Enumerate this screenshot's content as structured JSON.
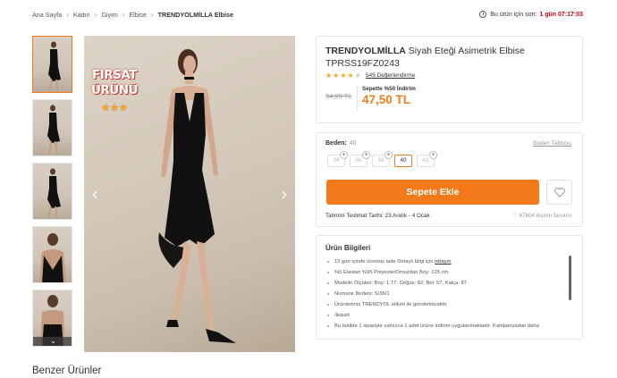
{
  "breadcrumb": [
    {
      "label": "Ana Sayfa"
    },
    {
      "label": "Kadın"
    },
    {
      "label": "Giyim"
    },
    {
      "label": "Elbise"
    },
    {
      "label": "TRENDYOLMİLLA Elbise"
    }
  ],
  "timer": {
    "label": "Bu ürün için son:",
    "value": "1 gün 07:17:03"
  },
  "badge": {
    "line1": "FIRSAT",
    "line2": "ÜRÜNÜ",
    "stars": "★★★"
  },
  "product": {
    "brand": "TRENDYOLMİLLA",
    "name": "Siyah Eteği Asimetrik Elbise",
    "code": "TPRSS19FZ0243",
    "rating": 4,
    "review_count": "549 Değerlendirme",
    "old_price": "94,99 TL",
    "discount_label": "Sepette %50 İndirim",
    "new_price": "47,50 TL"
  },
  "size": {
    "label": "Beden:",
    "selected": "40",
    "table_link": "Beden Tablosu",
    "options": [
      "34",
      "36",
      "38",
      "40",
      "42"
    ]
  },
  "cart": {
    "button": "Sepete Ekle"
  },
  "delivery": "Tahmini Teslimat Tarihi: 23 Aralık - 4 Ocak",
  "favorites": "67604 kişinin favorisi",
  "info": {
    "title": "Ürün Bilgileri",
    "items": [
      {
        "text": "15 gün içinde ücretsiz iade Detaylı bilgi için ",
        "link": "tıklayın"
      },
      {
        "text": "%5 Elastan %95 PolyesterOmuzdan Boy: 125 cm",
        "link": ""
      },
      {
        "text": "Modelin Ölçüleri: Boy: 1.77, Göğüs: 82, Bel: 57, Kalça: 87",
        "link": ""
      },
      {
        "text": "Numune Bedeni: S/36/1",
        "link": ""
      },
      {
        "text": "Ürünlerimiz TRENDYOL etiketi ile gönderilecektir",
        "link": ""
      },
      {
        "text": "/&quot",
        "link": ""
      },
      {
        "text": "Bu butikte 1 siparişte yalnızca 1 adet ürüne indirim uygulanmaktadır. Kampanyadan daha",
        "link": ""
      }
    ]
  },
  "similar": "Benzer Ürünler",
  "colors": {
    "accent": "#f27a1a",
    "timer": "#d0021b",
    "star": "#f5a623"
  }
}
